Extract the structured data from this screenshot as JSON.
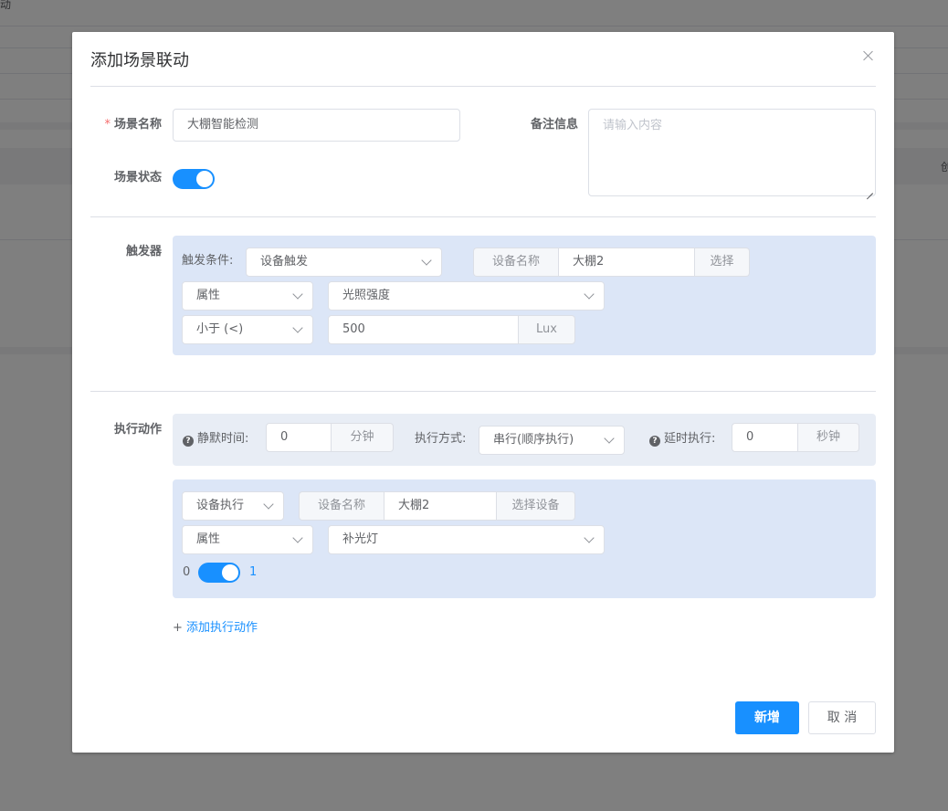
{
  "background": {
    "corner_text": "动",
    "right_text": "创"
  },
  "dialog": {
    "title": "添加场景联动",
    "scene_name": {
      "label": "场景名称",
      "required_mark": "*",
      "value": "大棚智能检测"
    },
    "remark": {
      "label": "备注信息",
      "placeholder": "请输入内容"
    },
    "scene_status": {
      "label": "场景状态",
      "on": true
    },
    "trigger": {
      "label": "触发器",
      "condition_label": "触发条件:",
      "condition_value": "设备触发",
      "device_prefix": "设备名称",
      "device_value": "大棚2",
      "device_select": "选择",
      "attr_type": "属性",
      "attr_value": "光照强度",
      "operator": "小于 (<)",
      "threshold": "500",
      "unit": "Lux"
    },
    "action": {
      "label": "执行动作",
      "silent_label": "静默时间:",
      "silent_value": "0",
      "silent_unit": "分钟",
      "mode_label": "执行方式:",
      "mode_value": "串行(顺序执行)",
      "delay_label": "延时执行:",
      "delay_value": "0",
      "delay_unit": "秒钟",
      "item": {
        "type": "设备执行",
        "device_prefix": "设备名称",
        "device_value": "大棚2",
        "device_select": "选择设备",
        "attr_type": "属性",
        "attr_value": "补光灯",
        "switch_off_label": "0",
        "switch_on_label": "1",
        "switch_on": true
      },
      "add_link_plus": "+",
      "add_link": "添加执行动作"
    },
    "buttons": {
      "submit": "新增",
      "cancel": "取 消"
    }
  },
  "colors": {
    "primary": "#1890ff",
    "panel": "#dce6f7",
    "required": "#f56c6c"
  },
  "icons": [
    "close-icon",
    "chevron-down-icon",
    "question-circle-icon"
  ]
}
